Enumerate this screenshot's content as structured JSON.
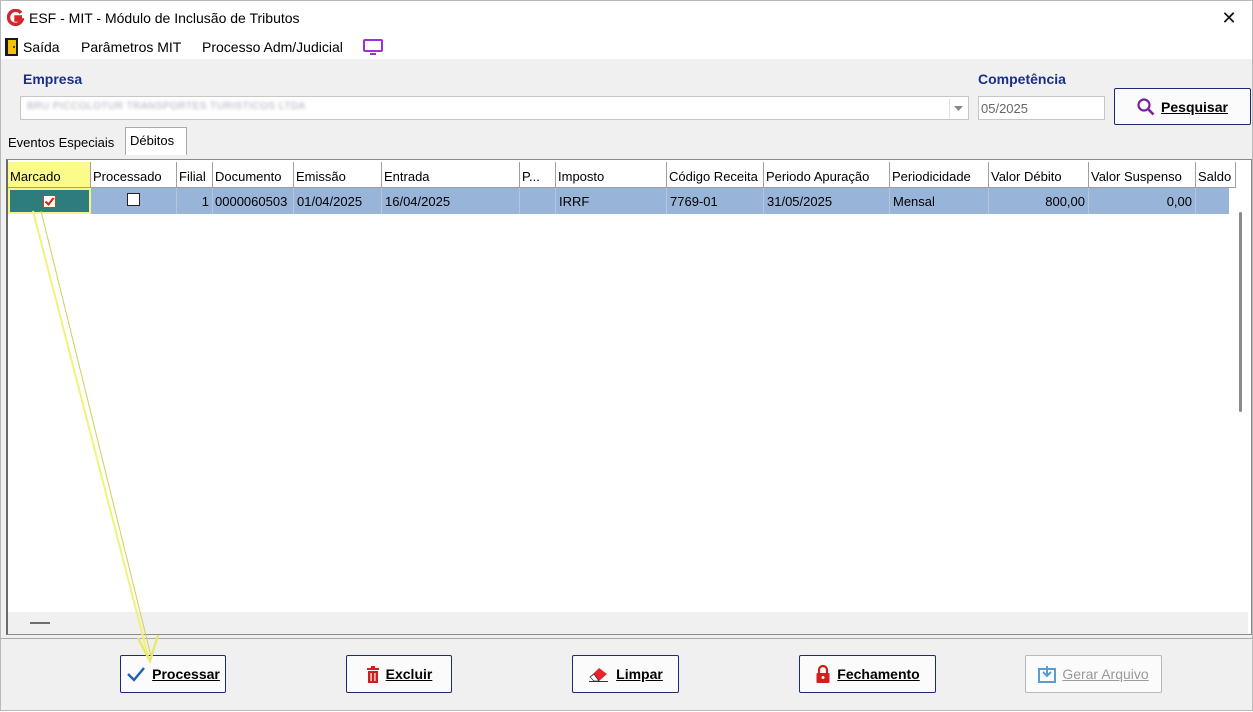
{
  "window": {
    "title": "ESF - MIT - Módulo de Inclusão de Tributos",
    "close_glyph": "✕"
  },
  "menu": {
    "items": [
      "Saída",
      "Parâmetros MIT",
      "Processo Adm/Judicial"
    ]
  },
  "filters": {
    "empresa_label": "Empresa",
    "empresa_value": "BRU PICCOLOTUR TRANSPORTES TURISTICOS LTDA",
    "competencia_label": "Competência",
    "competencia_value": "05/2025",
    "search_button": "Pesquisar"
  },
  "tabs": [
    "Eventos Especiais",
    "Débitos"
  ],
  "grid": {
    "columns": [
      "Marcado",
      "Processado",
      "Filial",
      "Documento",
      "Emissão",
      "Entrada",
      "P...",
      "Imposto",
      "Código Receita",
      "Periodo Apuração",
      "Periodicidade",
      "Valor Débito",
      "Valor Suspenso",
      "Saldo"
    ],
    "rows": [
      {
        "marcado": true,
        "processado": false,
        "filial": "1",
        "documento": "0000060503",
        "emissao": "01/04/2025",
        "entrada": "16/04/2025",
        "p": "",
        "imposto": "IRRF",
        "codigo_receita": "7769-01",
        "periodo_apuracao": "31/05/2025",
        "periodicidade": "Mensal",
        "valor_debito": "800,00",
        "valor_suspenso": "0,00",
        "saldo": ""
      }
    ]
  },
  "buttons": {
    "processar": "Processar",
    "excluir": "Excluir",
    "limpar": "Limpar",
    "fechamento": "Fechamento",
    "gerar_arquivo": "Gerar Arquivo"
  },
  "colors": {
    "label_blue": "#1a2f8a",
    "selected_row": "#99b4d9",
    "marked_header": "#fbfb8c",
    "annotation_arrow": "#f5f58a"
  }
}
